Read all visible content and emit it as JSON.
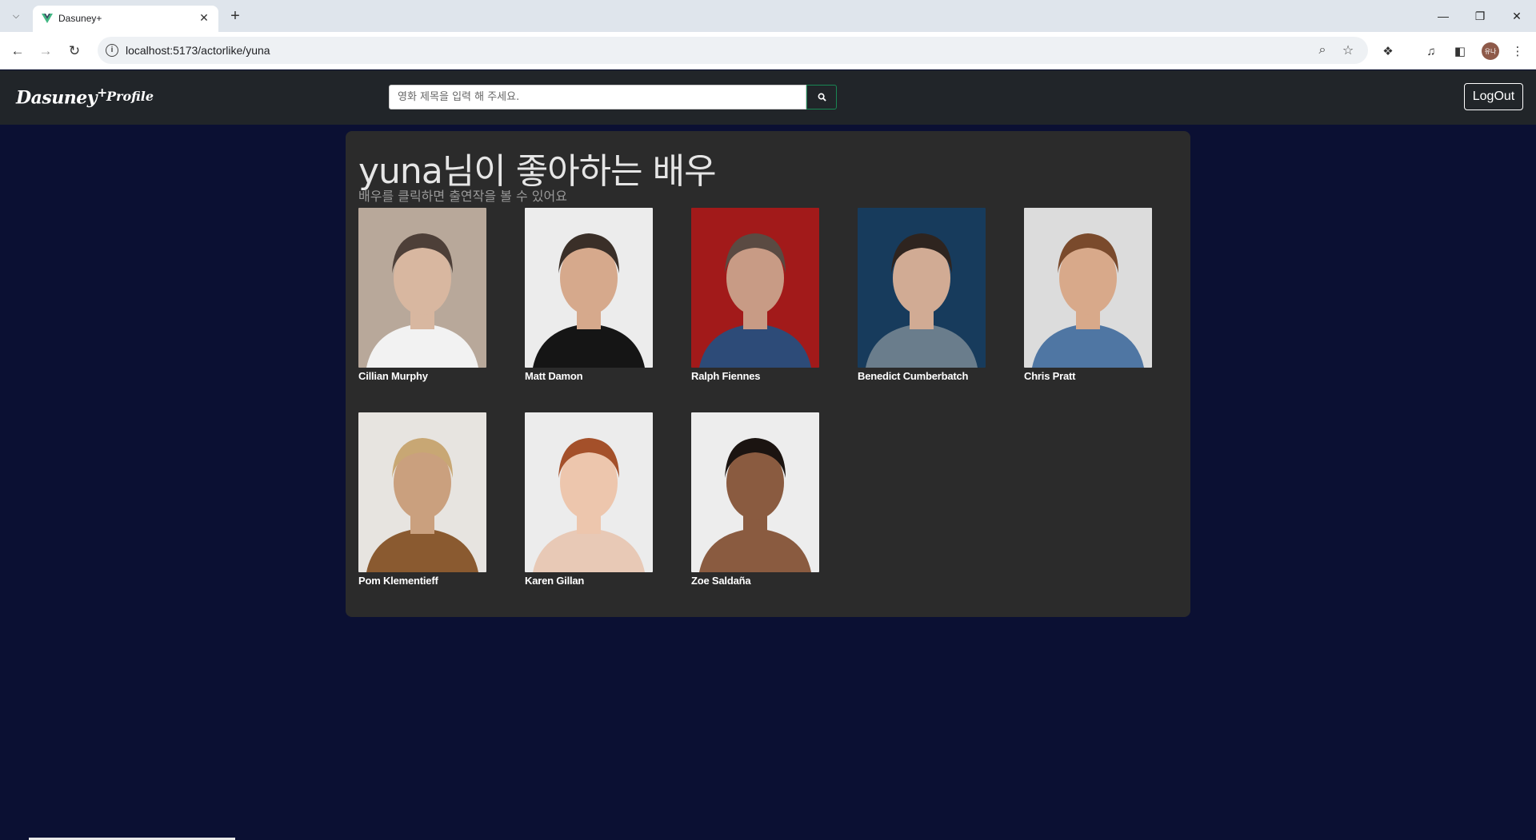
{
  "browser": {
    "tab_title": "Dasuney+",
    "url": "localhost:5173/actorlike/yuna",
    "profile_initials": "유나"
  },
  "navbar": {
    "brand": "Dasuney",
    "brand_plus": "+",
    "profile_link": "Profile",
    "search_placeholder": "영화 제목을 입력 해 주세요.",
    "logout_label": "LogOut"
  },
  "page": {
    "title": "yuna님이 좋아하는 배우",
    "subtitle": "배우를 클릭하면 출연작을 볼 수 있어요"
  },
  "actors": [
    {
      "name": "Cillian Murphy",
      "bg": "#b8a89a",
      "face": "#d8b7a0",
      "hair": "#4d3f38",
      "shirt": "#f2f2f2"
    },
    {
      "name": "Matt Damon",
      "bg": "#ececec",
      "face": "#d6a98c",
      "hair": "#3a2f28",
      "shirt": "#151515"
    },
    {
      "name": "Ralph Fiennes",
      "bg": "#a21a1a",
      "face": "#c89b85",
      "hair": "#5a4a42",
      "shirt": "#2d4b78"
    },
    {
      "name": "Benedict Cumberbatch",
      "bg": "#173b5c",
      "face": "#d1ab94",
      "hair": "#2e241f",
      "shirt": "#6a7d8c"
    },
    {
      "name": "Chris Pratt",
      "bg": "#dcdcdc",
      "face": "#d8a98a",
      "hair": "#7a4a2c",
      "shirt": "#4f76a3"
    },
    {
      "name": "Pom Klementieff",
      "bg": "#e7e4e0",
      "face": "#caa07e",
      "hair": "#c8a774",
      "shirt": "#8a5a30"
    },
    {
      "name": "Karen Gillan",
      "bg": "#ececec",
      "face": "#edc6ad",
      "hair": "#a4502a",
      "shirt": "#e8c9b6"
    },
    {
      "name": "Zoe Saldaña",
      "bg": "#ededed",
      "face": "#8a5b40",
      "hair": "#1b1411",
      "shirt": "#8a5b40"
    }
  ]
}
